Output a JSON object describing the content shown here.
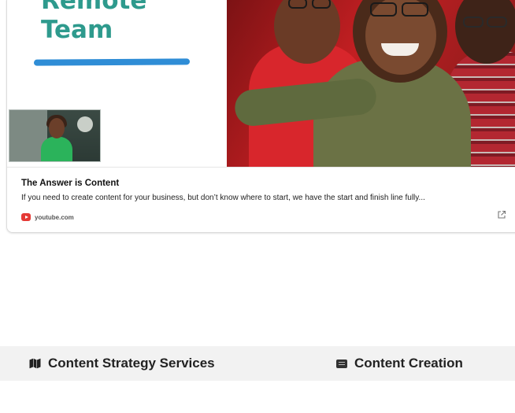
{
  "embed": {
    "thumbnail_headline_line1": "Remote",
    "thumbnail_headline_line2": "Team",
    "title": "The Answer is Content",
    "description": "If you need to create content for your business, but don’t know where to start, we have the start and finish line fully...",
    "source": "youtube.com"
  },
  "tabs": [
    {
      "label": "Content Strategy Services",
      "icon": "map-icon"
    },
    {
      "label": "Content Creation",
      "icon": "closed-captions-icon"
    }
  ],
  "colors": {
    "headline": "#2e9a8d",
    "brush_stroke": "#2f8dd6",
    "youtube_red": "#e53935",
    "tabbar_bg": "#f2f2f2"
  }
}
